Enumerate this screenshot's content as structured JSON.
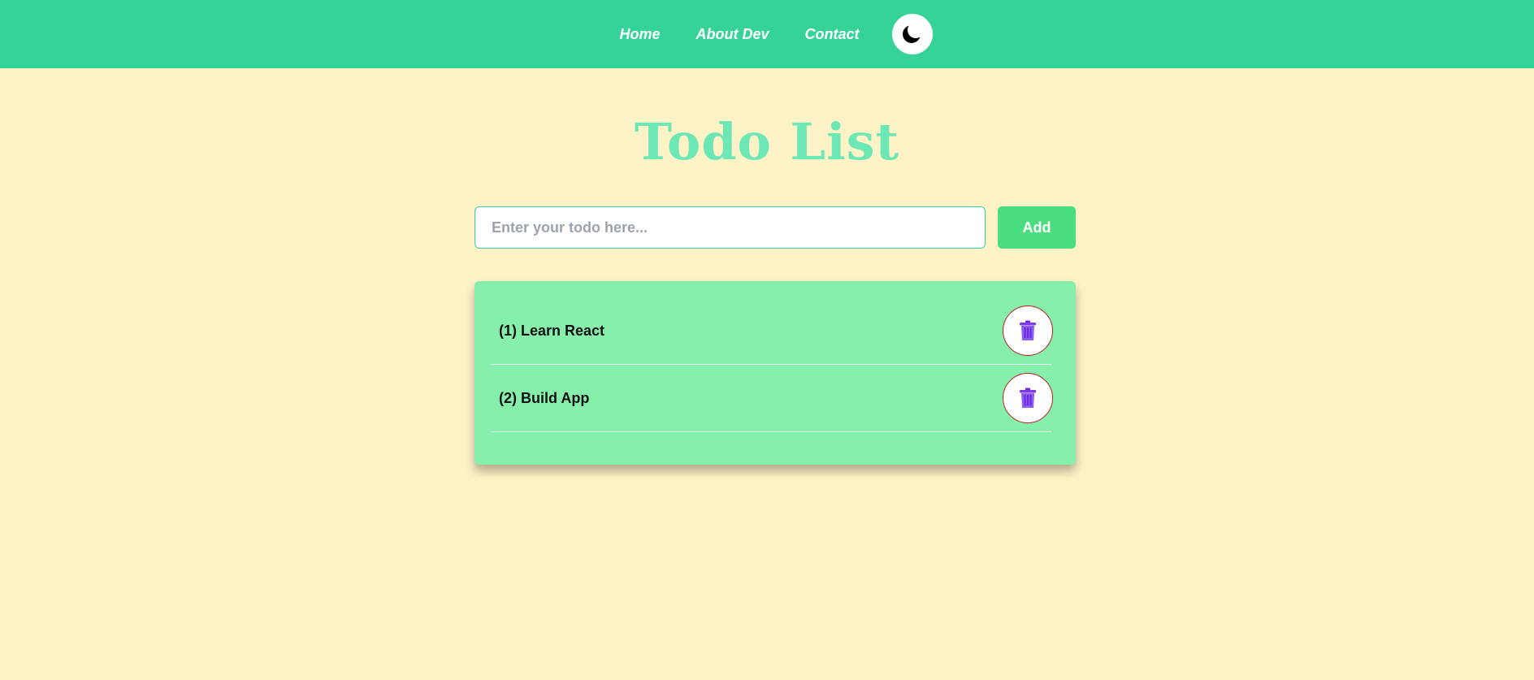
{
  "navbar": {
    "links": [
      "Home",
      "About Dev",
      "Contact"
    ],
    "theme_toggle_icon": "moon-icon",
    "background": "#36d399"
  },
  "main": {
    "title": "Todo List",
    "input": {
      "placeholder": "Enter your todo here...",
      "value": ""
    },
    "add_label": "Add",
    "todos": [
      {
        "text": "(1) Learn React",
        "delete_icon": "trash-icon"
      },
      {
        "text": "(2) Build App",
        "delete_icon": "trash-icon"
      }
    ]
  },
  "colors": {
    "page_background": "#fef3c7",
    "title": "#6ee7b7",
    "card": "#86efac",
    "add_button": "#4ade80",
    "trash_icon": "#8b5cf6"
  }
}
